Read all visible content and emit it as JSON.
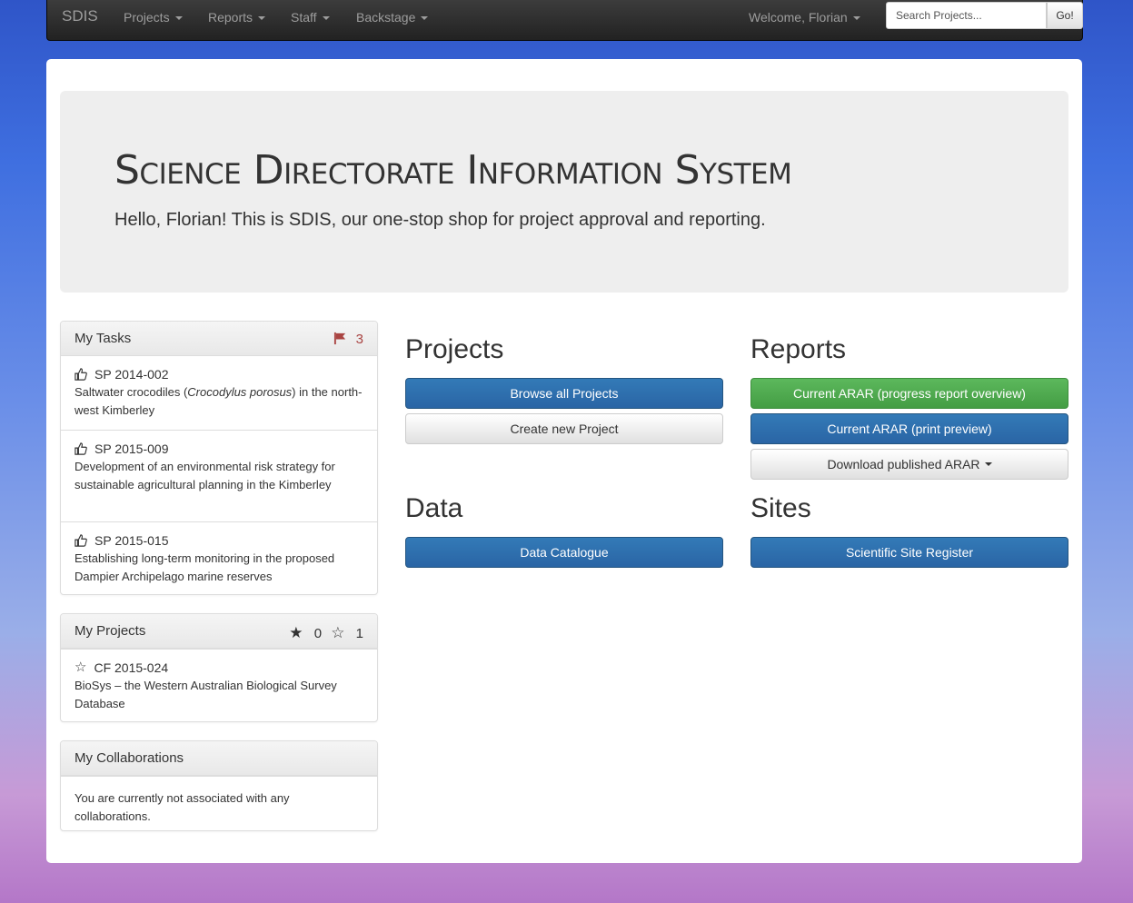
{
  "navbar": {
    "brand": "SDIS",
    "menu": [
      "Projects",
      "Reports",
      "Staff",
      "Backstage"
    ],
    "welcome": "Welcome, Florian",
    "search_placeholder": "Search Projects...",
    "go_label": "Go!"
  },
  "jumbotron": {
    "title": "Science Directorate Information System",
    "subtitle": "Hello, Florian! This is SDIS, our one-stop shop for project approval and reporting."
  },
  "tasks": {
    "title": "My Tasks",
    "count": "3",
    "items": [
      {
        "code": "SP 2014-002",
        "text_before": "Saltwater crocodiles (",
        "text_italic": "Crocodylus porosus",
        "text_after": ") in the north-west Kimberley"
      },
      {
        "code": "SP 2015-009",
        "text": "Development of an environmental risk strategy for sustainable agricultural planning in the Kimberley"
      },
      {
        "code": "SP 2015-015",
        "text": "Establishing long-term monitoring in the proposed Dampier Archipelago marine reserves"
      }
    ]
  },
  "projects_panel": {
    "title": "My Projects",
    "starred_count": "0",
    "unstarred_count": "1",
    "items": [
      {
        "code": "CF 2015-024",
        "text": "BioSys – the Western Australian Biological Survey Database"
      }
    ]
  },
  "collaborations": {
    "title": "My Collaborations",
    "text": "You are currently not associated with any collaborations."
  },
  "sections": {
    "projects": {
      "title": "Projects",
      "browse": "Browse all Projects",
      "create": "Create new Project"
    },
    "reports": {
      "title": "Reports",
      "arar_overview": "Current ARAR (progress report overview)",
      "arar_print": "Current ARAR (print preview)",
      "arar_download": "Download published ARAR"
    },
    "data": {
      "title": "Data",
      "catalogue": "Data Catalogue"
    },
    "sites": {
      "title": "Sites",
      "register": "Scientific Site Register"
    }
  },
  "colors": {
    "primary": "#337ab7",
    "success": "#5cb85c",
    "danger": "#a94442",
    "navbar": "#222222"
  }
}
